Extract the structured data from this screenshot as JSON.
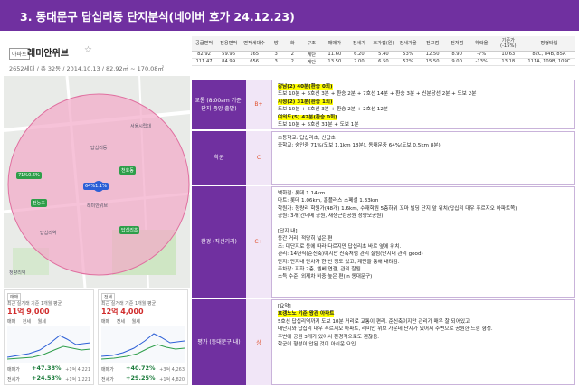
{
  "title": "3. 동대문구 답십리동 단지분석(네이버 호가 24.12.23)",
  "complex": {
    "tag": "아파트",
    "name": "래미안위브",
    "info": "2652세대 / 총 32동 / 2014.10.13 / 82.92㎡ ~ 170.08㎡"
  },
  "map": {
    "labels": [
      "71%0.6%",
      "64%1.1%",
      "천호동",
      "래미안위브",
      "전농초",
      "답십리초",
      "답십리역",
      "답십리동",
      "서울시립대",
      "청량리역"
    ]
  },
  "prices": [
    {
      "type": "매매",
      "label": "최근 실거래 기준 1개월 평균",
      "value": "11억 9,000",
      "tabs": [
        "매매",
        "전세",
        "월세"
      ],
      "change1_label": "매매가",
      "change1": "+47.38%",
      "change1_count": "+1억 4,221",
      "change2_label": "전세가",
      "change2": "+24.53%",
      "change2_count": "+1억 1,221"
    },
    {
      "type": "전세",
      "label": "최근 실거래 기준 1개월 평균",
      "value": "12억 4,000",
      "tabs": [
        "매매",
        "전세",
        "월세"
      ],
      "change1_label": "매매가",
      "change1": "+40.72%",
      "change1_count": "+3억 4,263",
      "change2_label": "전세가",
      "change2": "+29.25%",
      "change2_count": "+1억 4,820"
    }
  ],
  "table": {
    "headers": [
      "공급면적",
      "전용면적",
      "면적세대수",
      "방",
      "화",
      "구조",
      "매매가",
      "전세가",
      "호가갭(원)",
      "전세가율",
      "전고점",
      "전저점",
      "하락율",
      "기준가(-15%)",
      "평형타입"
    ],
    "rows": [
      [
        "82.92",
        "59.96",
        "165",
        "3",
        "2",
        "계단",
        "11.60",
        "6.20",
        "5.40",
        "53%",
        "12.50",
        "8.90",
        "-7%",
        "10.63",
        "82C, 84B, 85A"
      ],
      [
        "111.47",
        "84.99",
        "656",
        "3",
        "2",
        "계단",
        "13.50",
        "7.00",
        "6.50",
        "52%",
        "15.50",
        "9.00",
        "-13%",
        "13.18",
        "111A, 109B, 109C"
      ]
    ]
  },
  "evaluation": [
    {
      "category": "교통 (8:00am 기준, 단지 중앙 출발)",
      "grade": "B+",
      "lines": [
        {
          "hl": "강남(2) 40분(환승 0회)",
          "text": ""
        },
        {
          "hl": "",
          "text": "도보 10분 + 5호선 3분 + 환승 2분 + 7호선 14분 + 환승 3분 + 신분당선 2분 + 도보 2분"
        },
        {
          "hl": "시청(2) 31분(환승 1회)",
          "text": ""
        },
        {
          "hl": "",
          "text": "도보 10분 + 5호선 3분 + 환승 2분 + 2호선 12분"
        },
        {
          "hl": "여의도(5) 42분(환승 0회)",
          "text": ""
        },
        {
          "hl": "",
          "text": "도보 10분 + 5호선 31분 + 도보 1분"
        }
      ]
    },
    {
      "category": "학군",
      "grade": "C",
      "lines": [
        {
          "hl": "",
          "text": "초등학교: 답십리초, 신답초"
        },
        {
          "hl": "",
          "text": "중학교: 숭인중 71%(도보 1.1km 18분), 동대문중 64%(도보 0.5km 8분)"
        }
      ]
    },
    {
      "category": "환경 (직선거리)",
      "grade": "C+",
      "lines": [
        {
          "hl": "",
          "text": "백화점: 롯데 1.14km"
        },
        {
          "hl": "",
          "text": "마트: 롯데 1.06km, 홈플러스 스페셜 1.33km"
        },
        {
          "hl": "",
          "text": "학원가: 청량리 학원가(48개) 1.6km, 수재학원 5층하위 꼬마 빌딩 단지 앞 위치(답십리 대우 푸르지오 아파트쪽)"
        },
        {
          "hl": "",
          "text": "공원: 3개(간데메 공원, 새생근린공원 청량모공원)"
        },
        {
          "hl": "",
          "text": ""
        },
        {
          "hl": "",
          "text": "[단지 내]"
        },
        {
          "hl": "",
          "text": "동간 거리: 적당히 넓은 편"
        },
        {
          "hl": "",
          "text": "조: 대단지로 동에 따라 다르지만 답십리초 바로 옆에 위치."
        },
        {
          "hl": "",
          "text": "관리: 14년식(준신축)이지만 신축처럼 관리 잘됨(단지내 관리 good)"
        },
        {
          "hl": "",
          "text": "단지: 단지내 단차가 한 번 정도 있고, 계단을 통해 내려감."
        },
        {
          "hl": "",
          "text": "주차장: 지하 2층, 엘베 연결, 관리 잘됨."
        },
        {
          "hl": "",
          "text": "소득 수준: 외제차 비중 높은 편(in 동대문구)"
        }
      ]
    },
    {
      "category": "평가 (동대문구 내)",
      "grade": "상",
      "lines": [
        {
          "hl": "",
          "text": "[요약]"
        },
        {
          "hl": "호갱노노 기준 왕관 아파트",
          "text": ""
        },
        {
          "hl": "",
          "text": "5호선 답십리역까지 도보 10분 거리로 교통이 편리. 준신축이지만 관리가 매우 잘 되어있고"
        },
        {
          "hl": "",
          "text": "대단지와 답십리 대우 푸르지오 아파트, 래미안 위브 가운데 단지가 있어서 주변으로 공원한 느낌 형성."
        },
        {
          "hl": "",
          "text": "주변에 공원 3개가 있어서 환경적으로도 괜찮음."
        },
        {
          "hl": "",
          "text": "학군이 형성이 안된 것이 아쉬운 요인."
        }
      ]
    }
  ],
  "colors": {
    "accent": "#7030a0",
    "highlight": "#ffff00",
    "grade": "#e0502c"
  }
}
